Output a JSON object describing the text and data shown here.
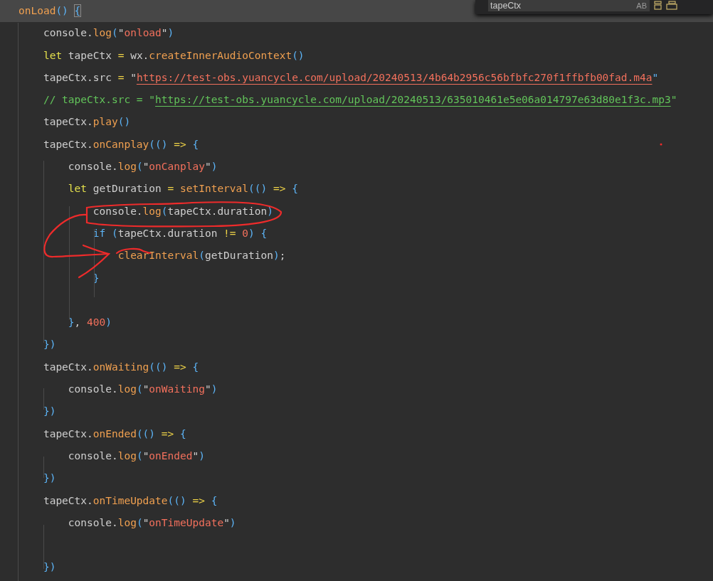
{
  "editor": {
    "lines": [
      {
        "highlighted": true,
        "tokens": [
          {
            "kind": "fn",
            "text": "onLoad"
          },
          {
            "kind": "paren",
            "text": "() "
          },
          {
            "kind": "bracket-match",
            "text": "{"
          }
        ]
      },
      {
        "highlighted": false,
        "tokens": [
          {
            "kind": "plain",
            "text": "    console."
          },
          {
            "kind": "fn",
            "text": "log"
          },
          {
            "kind": "paren",
            "text": "("
          },
          {
            "kind": "plain",
            "text": "\""
          },
          {
            "kind": "string",
            "text": "onload"
          },
          {
            "kind": "plain",
            "text": "\""
          },
          {
            "kind": "paren",
            "text": ")"
          }
        ]
      },
      {
        "highlighted": false,
        "tokens": [
          {
            "kind": "keyword",
            "text": "    let"
          },
          {
            "kind": "plain",
            "text": " tapeCtx "
          },
          {
            "kind": "operator",
            "text": "="
          },
          {
            "kind": "plain",
            "text": " wx."
          },
          {
            "kind": "fn",
            "text": "createInnerAudioContext"
          },
          {
            "kind": "paren",
            "text": "()"
          }
        ]
      },
      {
        "highlighted": false,
        "tokens": [
          {
            "kind": "plain",
            "text": "    tapeCtx.src "
          },
          {
            "kind": "operator",
            "text": "="
          },
          {
            "kind": "plain",
            "text": " \""
          },
          {
            "kind": "url",
            "text": "https://test-obs.yuancycle.com/upload/20240513/4b64b2956c56bfbfc270f1ffbfb00fad.m4a"
          },
          {
            "kind": "paren",
            "text": "\""
          }
        ]
      },
      {
        "highlighted": false,
        "tokens": [
          {
            "kind": "comment",
            "text": "    // tapeCtx.src = \""
          },
          {
            "kind": "comment-url",
            "text": "https://test-obs.yuancycle.com/upload/20240513/635010461e5e06a014797e63d80e1f3c.mp3"
          },
          {
            "kind": "comment",
            "text": "\""
          }
        ]
      },
      {
        "highlighted": false,
        "tokens": [
          {
            "kind": "plain",
            "text": "    tapeCtx."
          },
          {
            "kind": "fn",
            "text": "play"
          },
          {
            "kind": "paren",
            "text": "()"
          }
        ]
      },
      {
        "highlighted": false,
        "tokens": [
          {
            "kind": "plain",
            "text": "    tapeCtx."
          },
          {
            "kind": "fn",
            "text": "onCanplay"
          },
          {
            "kind": "paren",
            "text": "(() "
          },
          {
            "kind": "operator",
            "text": "=>"
          },
          {
            "kind": "paren",
            "text": " {"
          }
        ]
      },
      {
        "highlighted": false,
        "tokens": [
          {
            "kind": "plain",
            "text": "        console."
          },
          {
            "kind": "fn",
            "text": "log"
          },
          {
            "kind": "paren",
            "text": "("
          },
          {
            "kind": "plain",
            "text": "\""
          },
          {
            "kind": "string",
            "text": "onCanplay"
          },
          {
            "kind": "plain",
            "text": "\""
          },
          {
            "kind": "paren",
            "text": ")"
          }
        ]
      },
      {
        "highlighted": false,
        "tokens": [
          {
            "kind": "keyword",
            "text": "        let"
          },
          {
            "kind": "plain",
            "text": " getDuration "
          },
          {
            "kind": "operator",
            "text": "= "
          },
          {
            "kind": "fn",
            "text": "setInterval"
          },
          {
            "kind": "paren",
            "text": "(() "
          },
          {
            "kind": "operator",
            "text": "=>"
          },
          {
            "kind": "paren",
            "text": " {"
          }
        ]
      },
      {
        "highlighted": false,
        "tokens": [
          {
            "kind": "plain",
            "text": "            console."
          },
          {
            "kind": "fn",
            "text": "log"
          },
          {
            "kind": "paren",
            "text": "("
          },
          {
            "kind": "plain",
            "text": "tapeCtx.duration"
          },
          {
            "kind": "paren",
            "text": ")"
          }
        ]
      },
      {
        "highlighted": false,
        "tokens": [
          {
            "kind": "control",
            "text": "            if"
          },
          {
            "kind": "paren",
            "text": " ("
          },
          {
            "kind": "plain",
            "text": "tapeCtx.duration "
          },
          {
            "kind": "operator",
            "text": "!= "
          },
          {
            "kind": "number",
            "text": "0"
          },
          {
            "kind": "paren",
            "text": ") {"
          }
        ]
      },
      {
        "highlighted": false,
        "tokens": [
          {
            "kind": "fn",
            "text": "                clearInterval"
          },
          {
            "kind": "paren",
            "text": "("
          },
          {
            "kind": "plain",
            "text": "getDuration"
          },
          {
            "kind": "paren",
            "text": ")"
          },
          {
            "kind": "plain",
            "text": ";"
          }
        ]
      },
      {
        "highlighted": false,
        "tokens": [
          {
            "kind": "paren",
            "text": "            }"
          }
        ]
      },
      {
        "highlighted": false
      },
      {
        "highlighted": false,
        "tokens": [
          {
            "kind": "paren",
            "text": "        }"
          },
          {
            "kind": "plain",
            "text": ", "
          },
          {
            "kind": "number",
            "text": "400"
          },
          {
            "kind": "paren",
            "text": ")"
          }
        ]
      },
      {
        "highlighted": false,
        "tokens": [
          {
            "kind": "paren",
            "text": "    })"
          }
        ]
      },
      {
        "highlighted": false,
        "tokens": [
          {
            "kind": "plain",
            "text": "    tapeCtx."
          },
          {
            "kind": "fn",
            "text": "onWaiting"
          },
          {
            "kind": "paren",
            "text": "(() "
          },
          {
            "kind": "operator",
            "text": "=>"
          },
          {
            "kind": "paren",
            "text": " {"
          }
        ]
      },
      {
        "highlighted": false,
        "tokens": [
          {
            "kind": "plain",
            "text": "        console."
          },
          {
            "kind": "fn",
            "text": "log"
          },
          {
            "kind": "paren",
            "text": "("
          },
          {
            "kind": "plain",
            "text": "\""
          },
          {
            "kind": "string",
            "text": "onWaiting"
          },
          {
            "kind": "plain",
            "text": "\""
          },
          {
            "kind": "paren",
            "text": ")"
          }
        ]
      },
      {
        "highlighted": false,
        "tokens": [
          {
            "kind": "paren",
            "text": "    })"
          }
        ]
      },
      {
        "highlighted": false,
        "tokens": [
          {
            "kind": "plain",
            "text": "    tapeCtx."
          },
          {
            "kind": "fn",
            "text": "onEnded"
          },
          {
            "kind": "paren",
            "text": "(() "
          },
          {
            "kind": "operator",
            "text": "=>"
          },
          {
            "kind": "paren",
            "text": " {"
          }
        ]
      },
      {
        "highlighted": false,
        "tokens": [
          {
            "kind": "plain",
            "text": "        console."
          },
          {
            "kind": "fn",
            "text": "log"
          },
          {
            "kind": "paren",
            "text": "("
          },
          {
            "kind": "plain",
            "text": "\""
          },
          {
            "kind": "string",
            "text": "onEnded"
          },
          {
            "kind": "plain",
            "text": "\""
          },
          {
            "kind": "paren",
            "text": ")"
          }
        ]
      },
      {
        "highlighted": false,
        "tokens": [
          {
            "kind": "paren",
            "text": "    })"
          }
        ]
      },
      {
        "highlighted": false,
        "tokens": [
          {
            "kind": "plain",
            "text": "    tapeCtx."
          },
          {
            "kind": "fn",
            "text": "onTimeUpdate"
          },
          {
            "kind": "paren",
            "text": "(() "
          },
          {
            "kind": "operator",
            "text": "=>"
          },
          {
            "kind": "paren",
            "text": " {"
          }
        ]
      },
      {
        "highlighted": false,
        "tokens": [
          {
            "kind": "plain",
            "text": "        console."
          },
          {
            "kind": "fn",
            "text": "log"
          },
          {
            "kind": "paren",
            "text": "("
          },
          {
            "kind": "plain",
            "text": "\""
          },
          {
            "kind": "string",
            "text": "onTimeUpdate"
          },
          {
            "kind": "plain",
            "text": "\""
          },
          {
            "kind": "paren",
            "text": ")"
          }
        ]
      },
      {
        "highlighted": false
      },
      {
        "highlighted": false,
        "tokens": [
          {
            "kind": "paren",
            "text": "    })"
          }
        ]
      }
    ]
  },
  "find_widget": {
    "value": "tapeCtx",
    "match_case_label": "AB"
  }
}
